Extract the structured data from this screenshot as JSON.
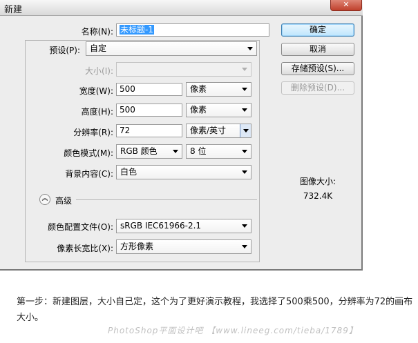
{
  "dialog": {
    "title": "新建",
    "close_glyph": "✕",
    "name": {
      "label": "名称(N):",
      "value": "未标题-1"
    },
    "preset": {
      "label": "预设(P):",
      "value": "自定"
    },
    "size": {
      "label": "大小(I):",
      "value": ""
    },
    "width": {
      "label": "宽度(W):",
      "value": "500",
      "unit": "像素"
    },
    "height": {
      "label": "高度(H):",
      "value": "500",
      "unit": "像素"
    },
    "resolution": {
      "label": "分辨率(R):",
      "value": "72",
      "unit": "像素/英寸"
    },
    "color_mode": {
      "label": "颜色模式(M):",
      "value": "RGB 颜色",
      "depth": "8 位"
    },
    "background": {
      "label": "背景内容(C):",
      "value": "白色"
    },
    "advanced": {
      "label": "高级",
      "icon": "collapse-chevron-icon"
    },
    "color_profile": {
      "label": "颜色配置文件(O):",
      "value": "sRGB IEC61966-2.1"
    },
    "pixel_aspect": {
      "label": "像素长宽比(X):",
      "value": "方形像素"
    },
    "buttons": {
      "ok": "确定",
      "cancel": "取消",
      "save_preset": "存储预设(S)...",
      "delete_preset": "删除预设(D)..."
    },
    "image_size": {
      "label": "图像大小:",
      "value": "732.4K"
    }
  },
  "caption": "第一步：新建图层，大小自己定，这个为了更好演示教程，我选择了500乘500，分辨率为72的画布大小。",
  "watermark": "PhotoShop平面设计吧 【www.lineeg.com/tieba/1789】",
  "colors": {
    "selection": "#3399ff",
    "primary_button": "#bee6fd",
    "dialog_bg": "#ededed"
  }
}
